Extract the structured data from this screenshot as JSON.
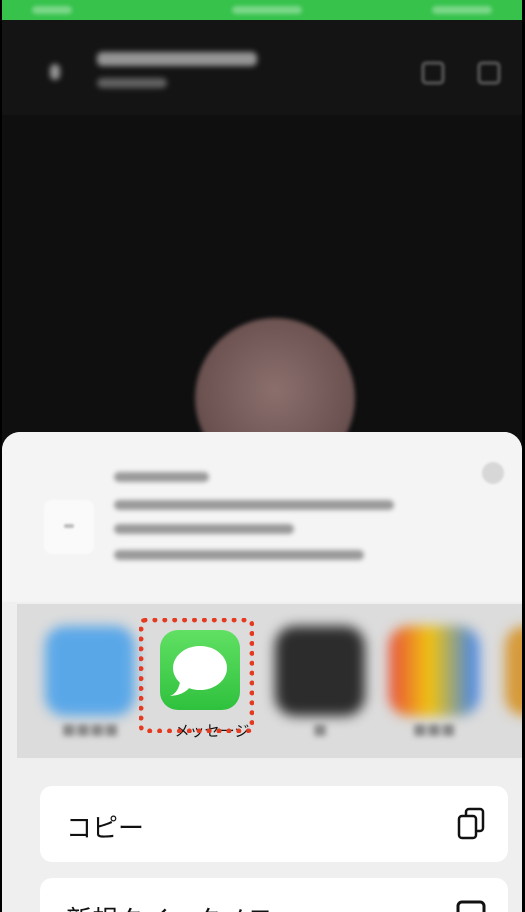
{
  "share_sheet": {
    "featured_app_label": "メッセージ",
    "featured_app_icon": "speech-bubble-icon",
    "accent_color": "#34c23f",
    "highlight_color": "#e53a1f"
  },
  "actions": [
    {
      "label": "コピー",
      "icon": "copy-icon"
    },
    {
      "label": "新規クイックメモ",
      "icon": "quick-note-icon"
    }
  ]
}
